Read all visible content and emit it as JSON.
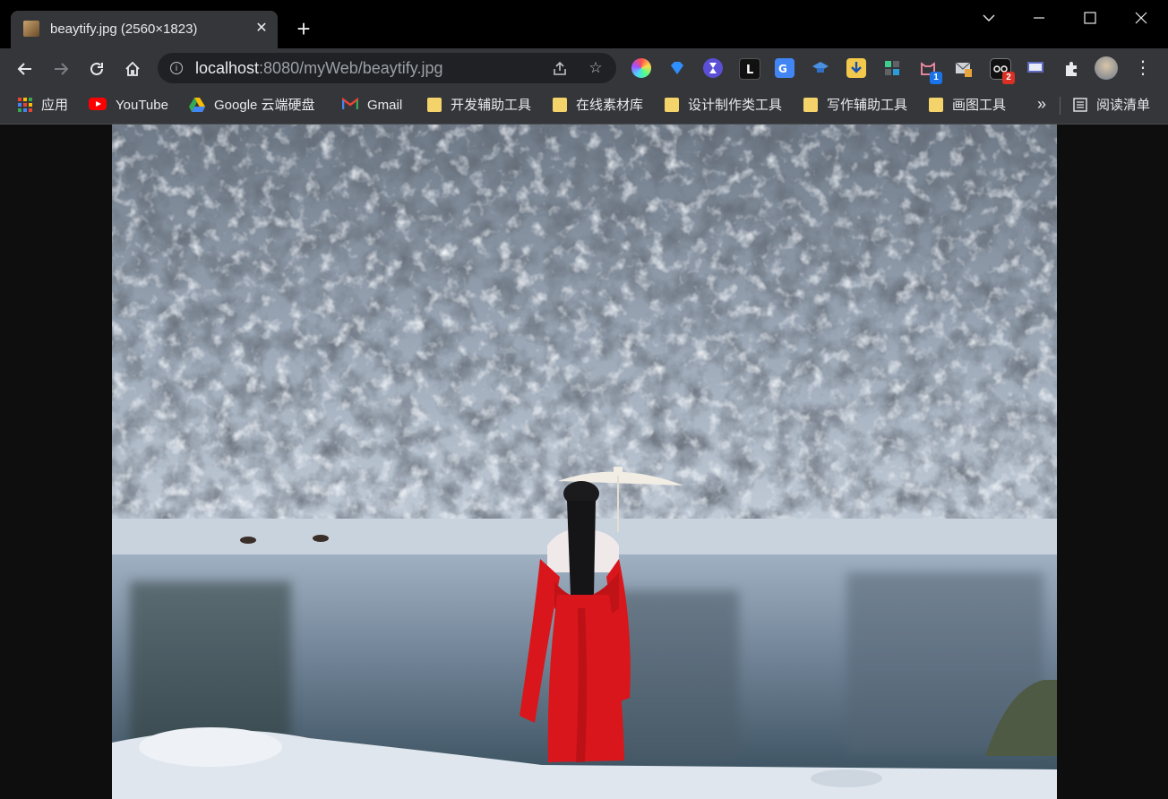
{
  "tab": {
    "title": "beaytify.jpg (2560×1823)",
    "close_icon": "close-icon"
  },
  "window": {
    "min_icon": "minimize-icon",
    "max_icon": "maximize-icon",
    "close_icon": "close-icon",
    "dropdown_icon": "chevron-down-icon"
  },
  "toolbar": {
    "url_host": "localhost",
    "url_rest": ":8080/myWeb/beaytify.jpg",
    "extension_badges": [
      "1",
      "2"
    ]
  },
  "bookmarks": {
    "items": [
      {
        "label": "应用",
        "icon": "apps-grid-icon"
      },
      {
        "label": "YouTube",
        "icon": "youtube-icon"
      },
      {
        "label": "Google 云端硬盘",
        "icon": "google-drive-icon"
      },
      {
        "label": "Gmail",
        "icon": "gmail-icon"
      },
      {
        "label": "开发辅助工具",
        "icon": "folder-icon"
      },
      {
        "label": "在线素材库",
        "icon": "folder-icon"
      },
      {
        "label": "设计制作类工具",
        "icon": "folder-icon"
      },
      {
        "label": "写作辅助工具",
        "icon": "folder-icon"
      },
      {
        "label": "画图工具",
        "icon": "folder-icon"
      }
    ],
    "reading_list": "阅读清单"
  },
  "image": {
    "alt": "beaytify.jpg"
  },
  "colors": {
    "tabstrip": "#000000",
    "toolbar": "#35363a",
    "omnibox": "#202124",
    "viewer_bg": "#0e0e0e",
    "accent_red": "#d9161b"
  }
}
